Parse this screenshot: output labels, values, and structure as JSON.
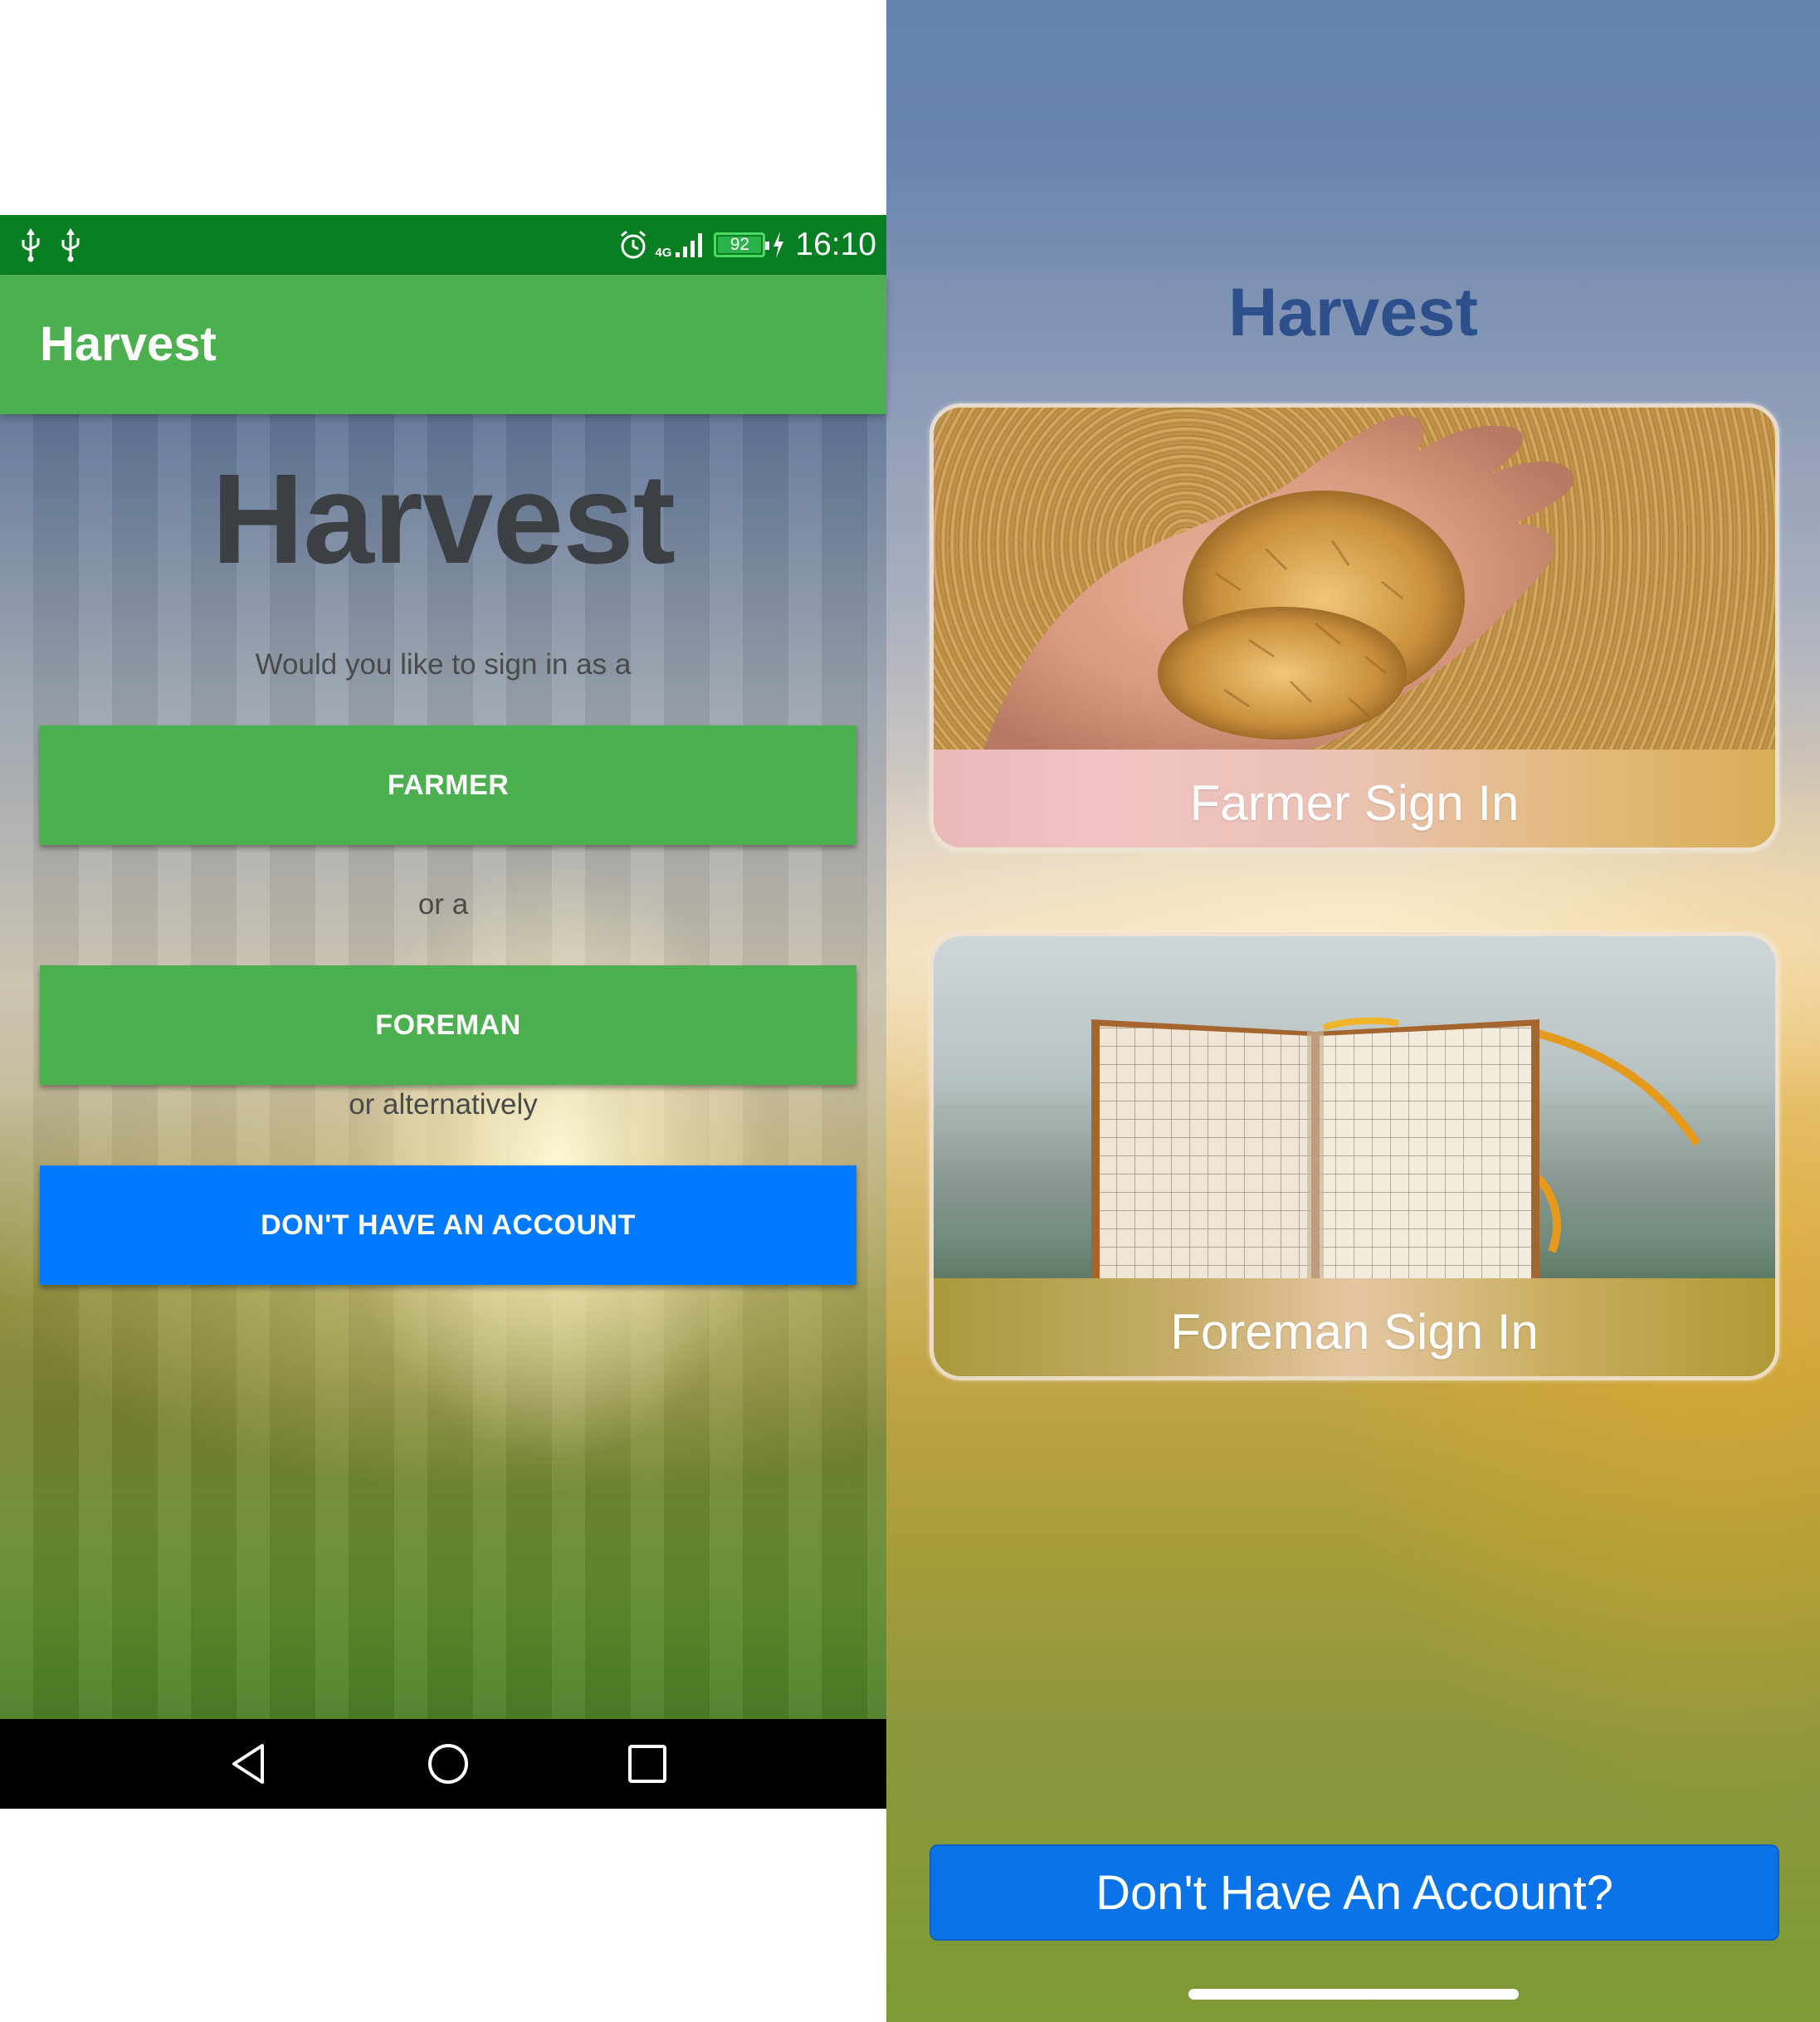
{
  "android": {
    "status_bar": {
      "time": "16:10",
      "battery_level": "92",
      "network": "4G",
      "icons": [
        "usb-icon",
        "usb-icon",
        "alarm-icon",
        "signal-icon",
        "battery-icon",
        "charging-icon"
      ]
    },
    "app_bar": {
      "title": "Harvest"
    },
    "content": {
      "title": "Harvest",
      "prompt": "Would you like to sign in as a",
      "farmer_button": "FARMER",
      "separator": "or a",
      "foreman_button": "FOREMAN",
      "alternative": "or alternatively",
      "account_button": "DON'T HAVE AN ACCOUNT"
    },
    "nav_bar": {
      "icons": [
        "back-icon",
        "home-icon",
        "recents-icon"
      ]
    },
    "colors": {
      "status_bar": "#087e23",
      "app_bar": "#4caf50",
      "primary_button": "#4caf50",
      "account_button": "#007aff"
    }
  },
  "ios": {
    "title": "Harvest",
    "farmer_card": {
      "label": "Farmer Sign In",
      "image": "hand-holding-grain"
    },
    "foreman_card": {
      "label": "Foreman Sign In",
      "image": "open-notebook"
    },
    "account_button": "Don't Have An Account?",
    "colors": {
      "title": "#2d4f8c",
      "account_button": "#0a73e8"
    }
  }
}
